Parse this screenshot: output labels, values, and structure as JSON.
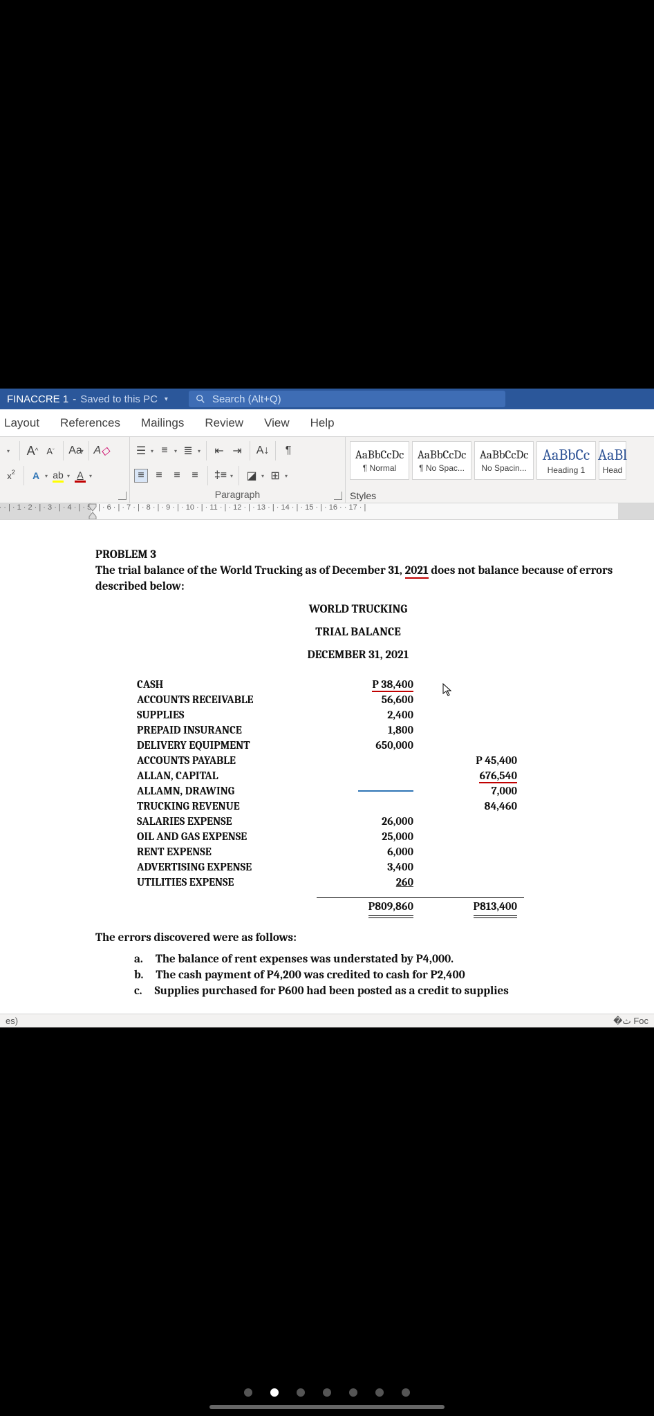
{
  "title": {
    "doc": "FINACCRE 1",
    "saved": "Saved to this PC"
  },
  "search": {
    "placeholder": "Search (Alt+Q)"
  },
  "menu": {
    "t0": "Layout",
    "t1": "References",
    "t2": "Mailings",
    "t3": "Review",
    "t4": "View",
    "t5": "Help"
  },
  "ribbon": {
    "paragraph_label": "Paragraph",
    "styles_label": "Styles",
    "styles": {
      "s0": {
        "sample": "AaBbCcDc",
        "name": "¶ Normal"
      },
      "s1": {
        "sample": "AaBbCcDc",
        "name": "¶ No Spac..."
      },
      "s2": {
        "sample": "AaBbCcDc",
        "name": "No Spacin..."
      },
      "s3": {
        "sample": "AaBbCc",
        "name": "Heading 1"
      },
      "s4": {
        "sample": "AaBl",
        "name": "Head"
      }
    }
  },
  "ruler": {
    "marks": "· 1 · | ·    · | · 1    · 2 · | · 3 · | · 4 · | · 5 · | · 6 · | · 7 · | · 8 · | · 9 · | · 10 · | · 11 · | · 12 · | · 13 · | · 14 · | · 15 · | · 16 ·    · 17 · |"
  },
  "doc": {
    "p_title": "PROBLEM 3",
    "intro_a": "The trial balance of the World Trucking as of December 31, ",
    "intro_year": "2021",
    "intro_b": " does not balance because of errors described below:",
    "h1": "WORLD TRUCKING",
    "h2": "TRIAL BALANCE",
    "h3": "DECEMBER 31, 2021",
    "rows": {
      "r0": {
        "a": "CASH",
        "d": "P  38,400",
        "c": ""
      },
      "r1": {
        "a": "ACCOUNTS RECEIVABLE",
        "d": "56,600",
        "c": ""
      },
      "r2": {
        "a": "SUPPLIES",
        "d": "2,400",
        "c": ""
      },
      "r3": {
        "a": "PREPAID INSURANCE",
        "d": "1,800",
        "c": ""
      },
      "r4": {
        "a": "DELIVERY EQUIPMENT",
        "d": "650,000",
        "c": ""
      },
      "r5": {
        "a": "ACCOUNTS PAYABLE",
        "d": "",
        "c": "P 45,400"
      },
      "r6": {
        "a": "ALLAN, CAPITAL",
        "d": "",
        "c": "676,540"
      },
      "r7": {
        "a": "ALLAMN, DRAWING",
        "d": "",
        "c": "7,000"
      },
      "r8": {
        "a": "TRUCKING REVENUE",
        "d": "",
        "c": "84,460"
      },
      "r9": {
        "a": "SALARIES EXPENSE",
        "d": "26,000",
        "c": ""
      },
      "r10": {
        "a": "OIL AND GAS EXPENSE",
        "d": "25,000",
        "c": ""
      },
      "r11": {
        "a": "RENT EXPENSE",
        "d": "6,000",
        "c": ""
      },
      "r12": {
        "a": "ADVERTISING EXPENSE",
        "d": "3,400",
        "c": ""
      },
      "r13": {
        "a": "UTILITIES EXPENSE",
        "d": "260",
        "c": ""
      }
    },
    "tot_d": "P809,860",
    "tot_c": "P813,400",
    "errs_h": "The errors discovered were as follows:",
    "e": {
      "a": {
        "k": "a.",
        "t": "The balance of rent expenses was understated by P4,000."
      },
      "b": {
        "k": "b.",
        "t": "The cash payment of P4,200 was credited to cash for P2,400"
      },
      "c": {
        "k": "c.",
        "t": "Supplies purchased for P600 had been posted as a credit to supplies"
      }
    }
  },
  "status": {
    "left": "es)",
    "right": "Foc"
  },
  "pager": {
    "count": 7,
    "active": 1
  }
}
